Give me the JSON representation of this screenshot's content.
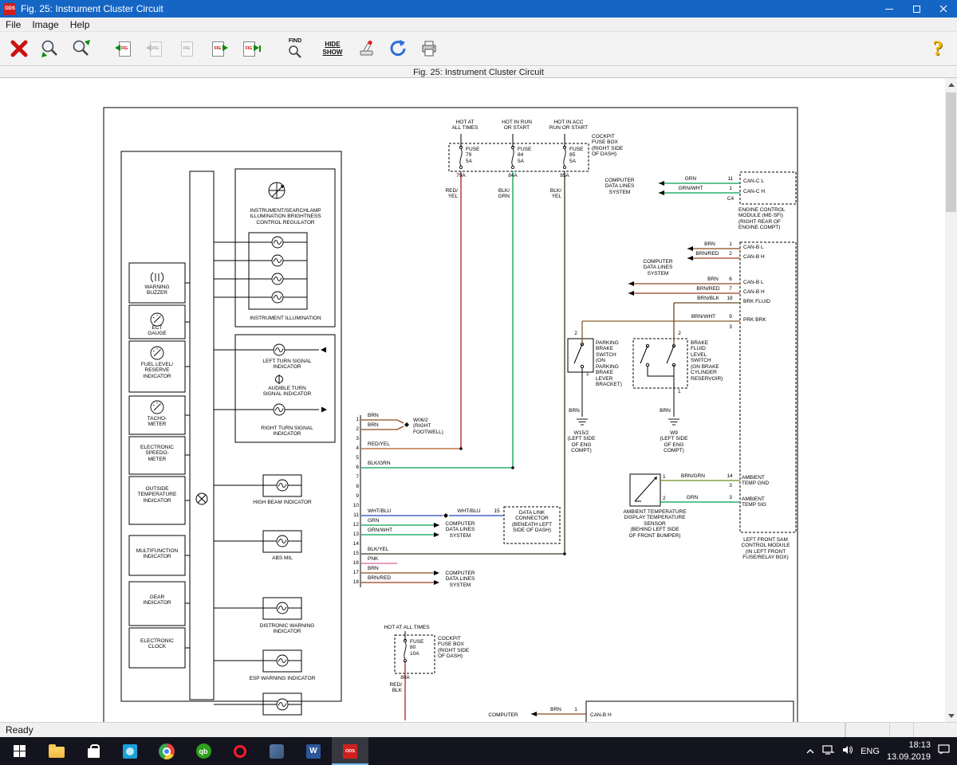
{
  "titlebar": {
    "app": "ODS",
    "title": "Fig. 25: Instrument Cluster Circuit"
  },
  "menu": {
    "items": [
      "File",
      "Image",
      "Help"
    ]
  },
  "toolbar": {
    "fig": "FIG",
    "find": "FIND",
    "hide": "HIDE",
    "show": "SHOW",
    "help": "?"
  },
  "figure_header": "Fig. 25: Instrument Cluster Circuit",
  "status": {
    "ready": "Ready"
  },
  "taskbar": {
    "time": "18:13",
    "date": "13.09.2019",
    "language": "ENG",
    "qb": "qb",
    "word": "W",
    "ods": "ODS"
  },
  "colors": {
    "titlebar": "#1566c4",
    "wire_green": "#00a14e",
    "wire_brown": "#8a4a1e",
    "wire_red": "#b22222",
    "wire_blue": "#2244bb",
    "wire_pink": "#e0629a"
  },
  "diagram": {
    "cdl": "COMPUTER\nDATA LINES\nSYSTEM",
    "top": {
      "hot1": "HOT AT\nALL TIMES",
      "hot2": "HOT IN RUN\nOR START",
      "hot3": "HOT IN ACC\nRUN OR START",
      "fuse79": "FUSE\n79\n5A",
      "fuse84": "FUSE\n84\n5A",
      "fuse85": "FUSE\n85\n5A",
      "cockpit": "COCKPIT\nFUSE BOX\n(RIGHT SIDE\nOF DASH)",
      "pins": [
        "79A",
        "84A",
        "85A"
      ],
      "w1": "RED/\nYEL",
      "w2": "BLK/\nGRN",
      "w3": "BLK/\nYEL"
    },
    "canc": {
      "w1": "GRN",
      "p1": "11",
      "w2": "GRN/WHT",
      "p2": "1",
      "c4": "C4",
      "t1": "CAN-C L",
      "t2": "CAN-C H",
      "ecm": "ENGINE CONTROL\nMODULE (ME-SFI)\n(RIGHT REAR OF\nENGINE COMPT)"
    },
    "canb1": {
      "w1": "BRN",
      "p1": "1",
      "t1": "CAN-B L",
      "w2": "BRN/RED",
      "p2": "2",
      "t2": "CAN-B H"
    },
    "canb2": {
      "w1": "BRN",
      "p1": "6",
      "t1": "CAN-B L",
      "w2": "BRN/RED",
      "p2": "7",
      "t2": "CAN-B H",
      "w3": "BRN/BLK",
      "p3": "18",
      "t3": "BRK FLUID"
    },
    "prk": {
      "w": "BRN/WHT",
      "p": "9",
      "t": "PRK BRK",
      "sub": "3"
    },
    "park": {
      "p2": "2",
      "p1": "1",
      "label": "PARKING\nBRAKE\nSWITCH\n(ON\nPARKING\nBRAKE\nLEVER\nBRACKET)",
      "wire": "BRN",
      "gnd": "W15/2\n(LEFT SIDE\nOF ENG\nCOMPT)"
    },
    "bfs": {
      "p2": "2",
      "p1": "1",
      "label": "BRAKE\nFLUID\nLEVEL\nSWITCH\n(ON BRAKE\nCYLINDER\nRESERVOIR)",
      "wire": "BRN",
      "gnd": "W9\n(LEFT SIDE\nOF ENG\nCOMPT)"
    },
    "ambient": {
      "p1": "1",
      "w1": "BRN/GRN",
      "mp1": "14",
      "sub1": "3",
      "t1": "AMBIENT\nTEMP GND",
      "p2": "2",
      "w2": "GRN",
      "mp2": "3",
      "t2": "AMBIENT\nTEMP SIG",
      "label": "AMBIENT TEMPERATURE\nDISPLAY TEMPERATURE\nSENSOR\n(BEHIND LEFT SIDE\nOF FRONT BUMPER)"
    },
    "sam": "LEFT FRONT SAM\nCONTROL MODULE\n(IN LEFT FRONT\nFUSE/RELAY BOX)",
    "cluster": {
      "regulator": "INSTRUMENT/SEARCHLAMP\nILLUMINATION BRIGHTNESS\nCONTROL REGULATOR",
      "illumination": "INSTRUMENT ILLUMINATION",
      "left_turn": "LEFT TURN SIGNAL\nINDICATOR",
      "audible": "AUDIBLE TURN\nSIGNAL INDICATOR",
      "right_turn": "RIGHT TURN SIGNAL\nINDICATOR",
      "high_beam": "HIGH BEAM INDICATOR",
      "abs": "ABS MIL",
      "distronic": "DISTRONIC WARNING\nINDICATOR",
      "esp": "ESP WARNING INDICATOR",
      "units": [
        "WARNING\nBUZZER",
        "ECT\nGAUGE",
        "FUEL LEVEL/\nRESERVE\nINDICATOR",
        "TACHO-\nMETER",
        "ELECTRONIC\nSPEEDO-\nMETER",
        "OUTSIDE\nTEMPERATURE\nINDICATOR",
        "MULTIFUNCTION\nINDICATOR",
        "GEAR\nINDICATOR",
        "ELECTRONIC\nCLOCK"
      ]
    },
    "connector": {
      "rows": [
        {
          "n": "1",
          "w": "BRN"
        },
        {
          "n": "2",
          "w": "BRN"
        },
        {
          "n": "3",
          "w": ""
        },
        {
          "n": "4",
          "w": "RED/YEL"
        },
        {
          "n": "5",
          "w": ""
        },
        {
          "n": "6",
          "w": "BLK/GRN"
        },
        {
          "n": "7",
          "w": ""
        },
        {
          "n": "8",
          "w": ""
        },
        {
          "n": "9",
          "w": ""
        },
        {
          "n": "10",
          "w": ""
        },
        {
          "n": "11",
          "w": "WHT/BLU"
        },
        {
          "n": "12",
          "w": "GRN"
        },
        {
          "n": "13",
          "w": "GRN/WHT"
        },
        {
          "n": "14",
          "w": ""
        },
        {
          "n": "15",
          "w": "BLK/YEL"
        },
        {
          "n": "16",
          "w": "PNK"
        },
        {
          "n": "17",
          "w": "BRN"
        },
        {
          "n": "18",
          "w": "BRN/RED"
        }
      ]
    },
    "w062": "W06/2\n(RIGHT\nFOOTWELL)",
    "dlc": {
      "w": "WHT/BLU",
      "p": "15",
      "label": "DATA LINK\nCONNECTOR\n(BENEATH LEFT\nSIDE OF DASH)"
    },
    "bottom": {
      "hot": "HOT AT ALL TIMES",
      "fuse": "FUSE\n80\n10A",
      "cockpit": "COCKPIT\nFUSE BOX\n(RIGHT SIDE\nOF DASH)",
      "pin": "80A",
      "wire": "RED/\nBLK",
      "computer": "COMPUTER",
      "brn": "BRN",
      "p1": "1",
      "canb": "CAN-B H"
    }
  }
}
